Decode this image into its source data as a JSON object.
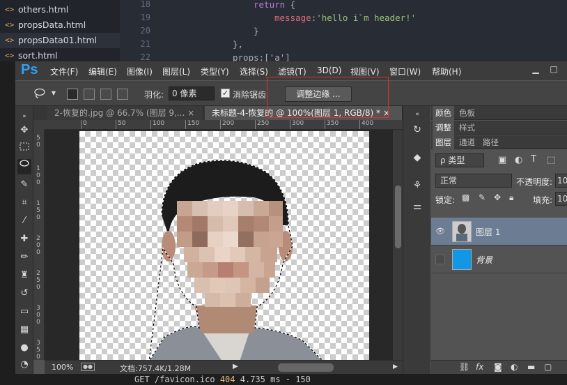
{
  "editor": {
    "files": [
      {
        "label": "others.html",
        "active": false
      },
      {
        "label": "propsData.html",
        "active": false
      },
      {
        "label": "propsData01.html",
        "active": true
      },
      {
        "label": "sort.html",
        "active": false
      }
    ],
    "file_icon": "<>",
    "line_numbers": [
      "18",
      "19",
      "20",
      "21",
      "22"
    ],
    "code": {
      "l18_kw": "return",
      "l18_rest": " {",
      "l19_prop": "message",
      "l19_colon": ":",
      "l19_str": "'hello i`m header!'",
      "l20": "}",
      "l21": "},",
      "l22": "props:['a']"
    }
  },
  "terminal": {
    "method_path": "GET /favicon.ico ",
    "status": "404",
    "rest": " 4.735 ms - 150"
  },
  "ps": {
    "logo": "Ps",
    "menus": [
      "文件(F)",
      "编辑(E)",
      "图像(I)",
      "图层(L)",
      "类型(Y)",
      "选择(S)",
      "滤镜(T)",
      "3D(D)",
      "视图(V)",
      "窗口(W)",
      "帮助(H)"
    ],
    "window_buttons": {
      "minimize": "▁",
      "maximize": "□",
      "close": "✕"
    },
    "options": {
      "tool_icon": "lasso-icon",
      "feather_label": "羽化:",
      "feather_value": "0 像素",
      "antialias_label": "消除锯齿",
      "antialias_checked": true,
      "refine_edge_label": "调整边缘 ..."
    },
    "tabs": [
      {
        "label": "2-恢复的.jpg @ 66.7% (图层 9,...",
        "close": "×",
        "active": false
      },
      {
        "label": "未标题-4-恢复的 @ 100%(图层 1, RGB/8) *",
        "close": "×",
        "active": true
      }
    ],
    "ruler_top_ticks": [
      "0",
      "50",
      "100",
      "150",
      "200",
      "250",
      "300",
      "350",
      "400"
    ],
    "ruler_left_ticks": [
      "5",
      "0",
      "1",
      "0",
      "0",
      "1",
      "5",
      "0",
      "2",
      "0",
      "0",
      "2",
      "5",
      "0",
      "3",
      "0",
      "0",
      "3",
      "5",
      "0"
    ],
    "status": {
      "zoom": "100%",
      "doc": "文档:757.4K/1.28M"
    },
    "panels": {
      "row1": [
        "颜色",
        "色板"
      ],
      "row2": [
        "调整",
        "样式"
      ],
      "row3": [
        "图层",
        "通道",
        "路径"
      ],
      "filter_label": "ρ 类型",
      "blend_mode": "正常",
      "opacity_label": "不透明度:",
      "opacity_value": "10",
      "lock_label": "锁定:",
      "fill_label": "填充:",
      "fill_value": "10",
      "layers": [
        {
          "name": "图层 1",
          "selected": true,
          "visible": true
        },
        {
          "name": "背景",
          "selected": false,
          "visible": false
        }
      ]
    },
    "colors": {
      "accent": "#30a1f5",
      "highlight_box": "#d9322e",
      "selected_layer": "#6b7c93",
      "background_layer": "#1296e6"
    }
  }
}
